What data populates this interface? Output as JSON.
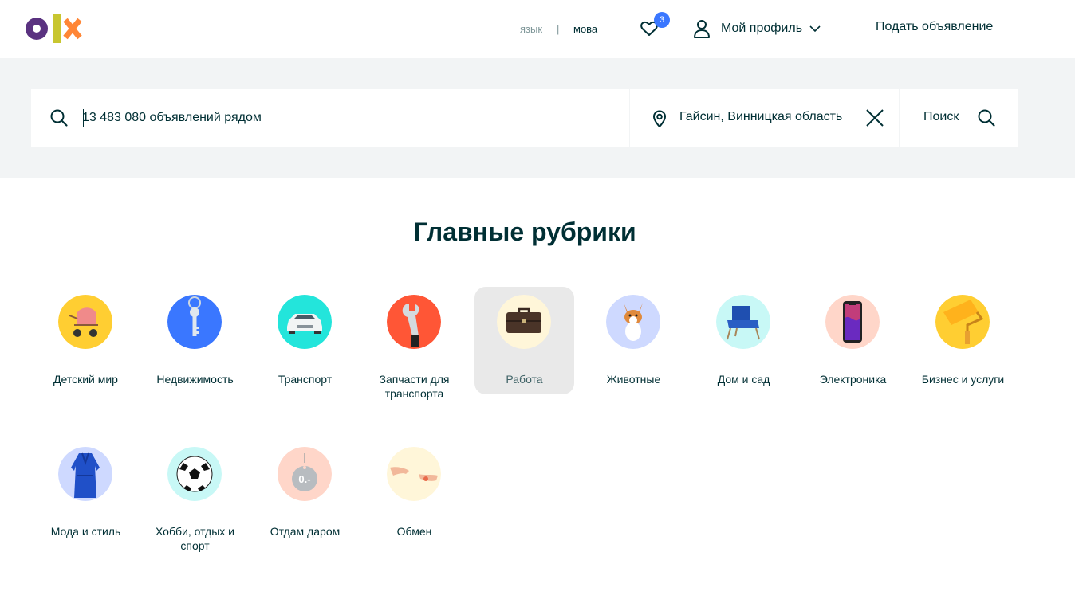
{
  "header": {
    "lang_ru": "язык",
    "lang_sep": "|",
    "lang_ua": "мова",
    "favorites_count": "3",
    "profile_label": "Мой профиль",
    "post_ad_label": "Подать объявление"
  },
  "search": {
    "placeholder": "13 483 080 объявлений рядом",
    "location": "Гайсин, Винницкая область",
    "button_label": "Поиск"
  },
  "section": {
    "title": "Главные рубрики"
  },
  "categories": [
    {
      "label": "Детский мир",
      "bg": "#ffce32"
    },
    {
      "label": "Недвижимость",
      "bg": "#3a77ff"
    },
    {
      "label": "Транспорт",
      "bg": "#23e5db"
    },
    {
      "label": "Запчасти для транспорта",
      "bg": "#ff5636"
    },
    {
      "label": "Работа",
      "bg": "#fff6d9"
    },
    {
      "label": "Животные",
      "bg": "#ced9ff"
    },
    {
      "label": "Дом и сад",
      "bg": "#c8f8f6"
    },
    {
      "label": "Электроника",
      "bg": "#ffd6c9"
    },
    {
      "label": "Бизнес и услуги",
      "bg": "#ffce32"
    },
    {
      "label": "Мода и стиль",
      "bg": "#ced9ff"
    },
    {
      "label": "Хобби, отдых и спорт",
      "bg": "#c8f8f6"
    },
    {
      "label": "Отдам даром",
      "bg": "#ffd6c9"
    },
    {
      "label": "Обмен",
      "bg": "#fff6d9"
    }
  ],
  "colors": {
    "text": "#002f34",
    "band": "#f2f4f5",
    "badge": "#3a77ff",
    "logo_purple": "#5a3280",
    "logo_green": "#c8c630",
    "logo_orange": "#ff8636"
  }
}
